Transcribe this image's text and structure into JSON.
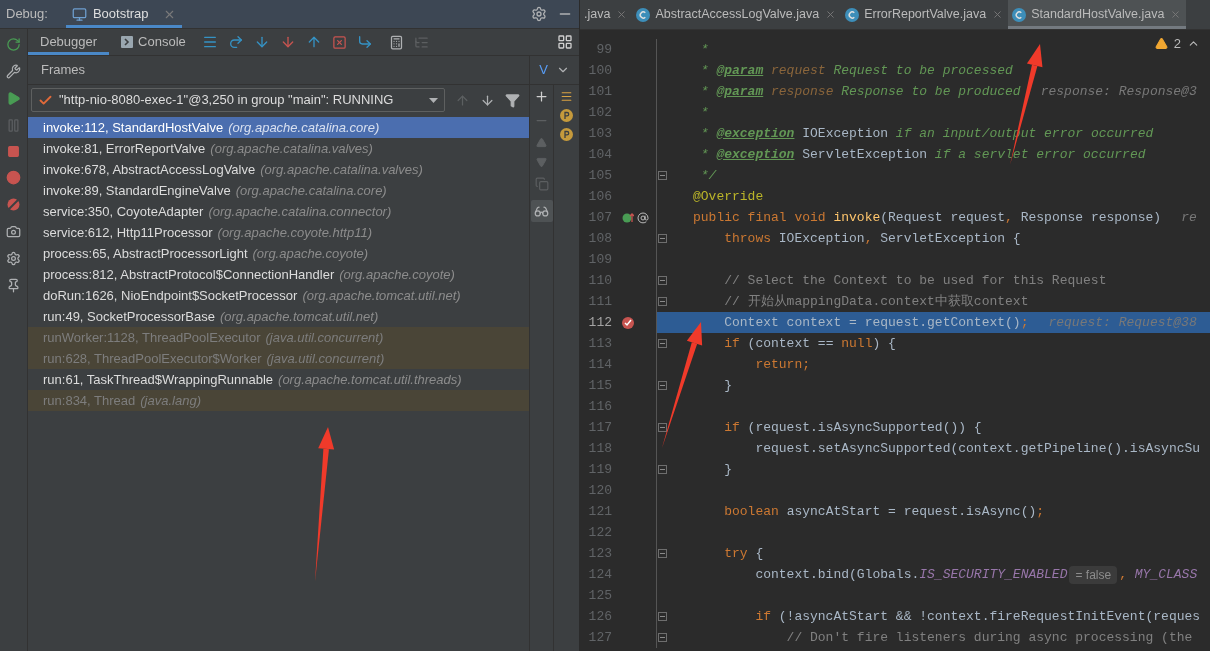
{
  "debug_bar": {
    "label": "Debug:",
    "tab": {
      "label": "Bootstrap",
      "selected": true
    }
  },
  "debugger_tabs": [
    {
      "label": "Debugger",
      "selected": true
    },
    {
      "label": "Console",
      "selected": false
    }
  ],
  "frames": {
    "title": "Frames",
    "variables_header": "V",
    "thread": {
      "label": "\"http-nio-8080-exec-1\"@3,250 in group \"main\": RUNNING"
    },
    "rows": [
      {
        "method": "invoke:112, StandardHostValve",
        "package": "(org.apache.catalina.core)",
        "kind": "app",
        "selected": true
      },
      {
        "method": "invoke:81, ErrorReportValve",
        "package": "(org.apache.catalina.valves)",
        "kind": "app",
        "selected": false
      },
      {
        "method": "invoke:678, AbstractAccessLogValve",
        "package": "(org.apache.catalina.valves)",
        "kind": "app",
        "selected": false
      },
      {
        "method": "invoke:89, StandardEngineValve",
        "package": "(org.apache.catalina.core)",
        "kind": "app",
        "selected": false
      },
      {
        "method": "service:350, CoyoteAdapter",
        "package": "(org.apache.catalina.connector)",
        "kind": "app",
        "selected": false
      },
      {
        "method": "service:612, Http11Processor",
        "package": "(org.apache.coyote.http11)",
        "kind": "app",
        "selected": false
      },
      {
        "method": "process:65, AbstractProcessorLight",
        "package": "(org.apache.coyote)",
        "kind": "app",
        "selected": false
      },
      {
        "method": "process:812, AbstractProtocol$ConnectionHandler",
        "package": "(org.apache.coyote)",
        "kind": "app",
        "selected": false
      },
      {
        "method": "doRun:1626, NioEndpoint$SocketProcessor",
        "package": "(org.apache.tomcat.util.net)",
        "kind": "app",
        "selected": false
      },
      {
        "method": "run:49, SocketProcessorBase",
        "package": "(org.apache.tomcat.util.net)",
        "kind": "app",
        "selected": false
      },
      {
        "method": "runWorker:1128, ThreadPoolExecutor",
        "package": "(java.util.concurrent)",
        "kind": "library",
        "selected": false
      },
      {
        "method": "run:628, ThreadPoolExecutor$Worker",
        "package": "(java.util.concurrent)",
        "kind": "library",
        "selected": false
      },
      {
        "method": "run:61, TaskThread$WrappingRunnable",
        "package": "(org.apache.tomcat.util.threads)",
        "kind": "app",
        "selected": false
      },
      {
        "method": "run:834, Thread",
        "package": "(java.lang)",
        "kind": "library",
        "selected": false
      }
    ]
  },
  "editor": {
    "tabs": [
      {
        "label": ".java",
        "selected": false,
        "has_icon": false
      },
      {
        "label": "AbstractAccessLogValve.java",
        "selected": false,
        "has_icon": true
      },
      {
        "label": "ErrorReportValve.java",
        "selected": false,
        "has_icon": true
      },
      {
        "label": "StandardHostValve.java",
        "selected": true,
        "has_icon": true
      }
    ],
    "warnings": "2",
    "lines": [
      {
        "num": "99",
        "kind": "plain",
        "fold": false,
        "current": false,
        "tokens": [
          {
            "kind": "doc",
            "t": " *"
          }
        ]
      },
      {
        "num": "100",
        "kind": "plain",
        "fold": false,
        "current": false,
        "tokens": [
          {
            "kind": "doc",
            "t": " * "
          },
          {
            "kind": "doctag",
            "t": "@param"
          },
          {
            "kind": "docparam",
            "t": " request"
          },
          {
            "kind": "doc",
            "t": " Request to be processed"
          }
        ]
      },
      {
        "num": "101",
        "kind": "plain",
        "fold": false,
        "current": false,
        "tokens": [
          {
            "kind": "doc",
            "t": " * "
          },
          {
            "kind": "doctag",
            "t": "@param"
          },
          {
            "kind": "docparam",
            "t": " response"
          },
          {
            "kind": "doc",
            "t": " Response to be produced"
          },
          {
            "kind": "hint",
            "t": "response: Response@3"
          }
        ]
      },
      {
        "num": "102",
        "kind": "plain",
        "fold": false,
        "current": false,
        "tokens": [
          {
            "kind": "doc",
            "t": " *"
          }
        ]
      },
      {
        "num": "103",
        "kind": "plain",
        "fold": false,
        "current": false,
        "tokens": [
          {
            "kind": "doc",
            "t": " * "
          },
          {
            "kind": "doctag",
            "t": "@exception"
          },
          {
            "kind": "plain",
            "t": " IOException"
          },
          {
            "kind": "doc",
            "t": " if an input/output error occurred"
          }
        ]
      },
      {
        "num": "104",
        "kind": "plain",
        "fold": false,
        "current": false,
        "tokens": [
          {
            "kind": "doc",
            "t": " * "
          },
          {
            "kind": "doctag",
            "t": "@exception"
          },
          {
            "kind": "plain",
            "t": " ServletException"
          },
          {
            "kind": "doc",
            "t": " if a servlet error occurred"
          }
        ]
      },
      {
        "num": "105",
        "kind": "plain",
        "fold": true,
        "current": false,
        "tokens": [
          {
            "kind": "doc",
            "t": " */"
          }
        ]
      },
      {
        "num": "106",
        "kind": "plain",
        "fold": false,
        "current": false,
        "tokens": [
          {
            "kind": "ann",
            "t": "@Override"
          }
        ]
      },
      {
        "num": "107",
        "kind": "override",
        "fold": false,
        "current": false,
        "tokens": [
          {
            "kind": "kw",
            "t": "public final void "
          },
          {
            "kind": "fn",
            "t": "invoke"
          },
          {
            "kind": "plain",
            "t": "(Request request"
          },
          {
            "kind": "kw",
            "t": ", "
          },
          {
            "kind": "plain",
            "t": "Response response)"
          },
          {
            "kind": "hint",
            "t": "re"
          }
        ]
      },
      {
        "num": "108",
        "kind": "plain",
        "fold": true,
        "current": false,
        "tokens": [
          {
            "kind": "kw",
            "t": "    throws"
          },
          {
            "kind": "plain",
            "t": " IOException"
          },
          {
            "kind": "kw",
            "t": ", "
          },
          {
            "kind": "plain",
            "t": "ServletException {"
          }
        ]
      },
      {
        "num": "109",
        "kind": "plain",
        "fold": false,
        "current": false
      },
      {
        "num": "110",
        "kind": "plain",
        "fold": true,
        "current": false,
        "tokens": [
          {
            "kind": "comment",
            "t": "    // Select the Context to be used for this Request"
          }
        ]
      },
      {
        "num": "111",
        "kind": "plain",
        "fold": true,
        "current": false,
        "tokens": [
          {
            "kind": "comment",
            "t": "    // 开始从mappingData.context中获取context"
          }
        ]
      },
      {
        "num": "112",
        "kind": "breakpoint",
        "fold": false,
        "current": true,
        "tokens": [
          {
            "kind": "plain",
            "t": "    Context context = request.getContext()"
          },
          {
            "kind": "kw",
            "t": ";"
          },
          {
            "kind": "hint",
            "t": "request: Request@38"
          }
        ]
      },
      {
        "num": "113",
        "kind": "plain",
        "fold": true,
        "current": false,
        "tokens": [
          {
            "kind": "kw",
            "t": "    if"
          },
          {
            "kind": "plain",
            "t": " (context == "
          },
          {
            "kind": "kw",
            "t": "null"
          },
          {
            "kind": "plain",
            "t": ") {"
          }
        ]
      },
      {
        "num": "114",
        "kind": "plain",
        "fold": false,
        "current": false,
        "tokens": [
          {
            "kind": "kw",
            "t": "        return;"
          }
        ]
      },
      {
        "num": "115",
        "kind": "plain",
        "fold": true,
        "current": false,
        "tokens": [
          {
            "kind": "plain",
            "t": "    }"
          }
        ]
      },
      {
        "num": "116",
        "kind": "plain",
        "fold": false,
        "current": false
      },
      {
        "num": "117",
        "kind": "plain",
        "fold": true,
        "current": false,
        "tokens": [
          {
            "kind": "kw",
            "t": "    if"
          },
          {
            "kind": "plain",
            "t": " (request.isAsyncSupported()) {"
          }
        ]
      },
      {
        "num": "118",
        "kind": "plain",
        "fold": false,
        "current": false,
        "tokens": [
          {
            "kind": "plain",
            "t": "        request.setAsyncSupported(context.getPipeline().isAsyncSu"
          }
        ]
      },
      {
        "num": "119",
        "kind": "plain",
        "fold": true,
        "current": false,
        "tokens": [
          {
            "kind": "plain",
            "t": "    }"
          }
        ]
      },
      {
        "num": "120",
        "kind": "plain",
        "fold": false,
        "current": false
      },
      {
        "num": "121",
        "kind": "plain",
        "fold": false,
        "current": false,
        "tokens": [
          {
            "kind": "kw",
            "t": "    boolean"
          },
          {
            "kind": "plain",
            "t": " asyncAtStart = request.isAsync()"
          },
          {
            "kind": "kw",
            "t": ";"
          }
        ]
      },
      {
        "num": "122",
        "kind": "plain",
        "fold": false,
        "current": false
      },
      {
        "num": "123",
        "kind": "plain",
        "fold": true,
        "current": false,
        "tokens": [
          {
            "kind": "kw",
            "t": "    try"
          },
          {
            "kind": "plain",
            "t": " {"
          }
        ]
      },
      {
        "num": "124",
        "kind": "plain",
        "fold": false,
        "current": false,
        "tokens": [
          {
            "kind": "plain",
            "t": "        context.bind(Globals."
          },
          {
            "kind": "const",
            "t": "IS_SECURITY_ENABLED"
          },
          {
            "kind": "badge",
            "t": "= false"
          },
          {
            "kind": "kw",
            "t": ", "
          },
          {
            "kind": "const",
            "t": "MY_CLASS"
          }
        ]
      },
      {
        "num": "125",
        "kind": "plain",
        "fold": false,
        "current": false
      },
      {
        "num": "126",
        "kind": "plain",
        "fold": true,
        "current": false,
        "tokens": [
          {
            "kind": "kw",
            "t": "        if"
          },
          {
            "kind": "plain",
            "t": " (!asyncAtStart && !context.fireRequestInitEvent(reques"
          }
        ]
      },
      {
        "num": "127",
        "kind": "plain",
        "fold": true,
        "current": false,
        "tokens": [
          {
            "kind": "comment",
            "t": "            // Don't fire listeners during async processing (the"
          }
        ]
      }
    ]
  }
}
